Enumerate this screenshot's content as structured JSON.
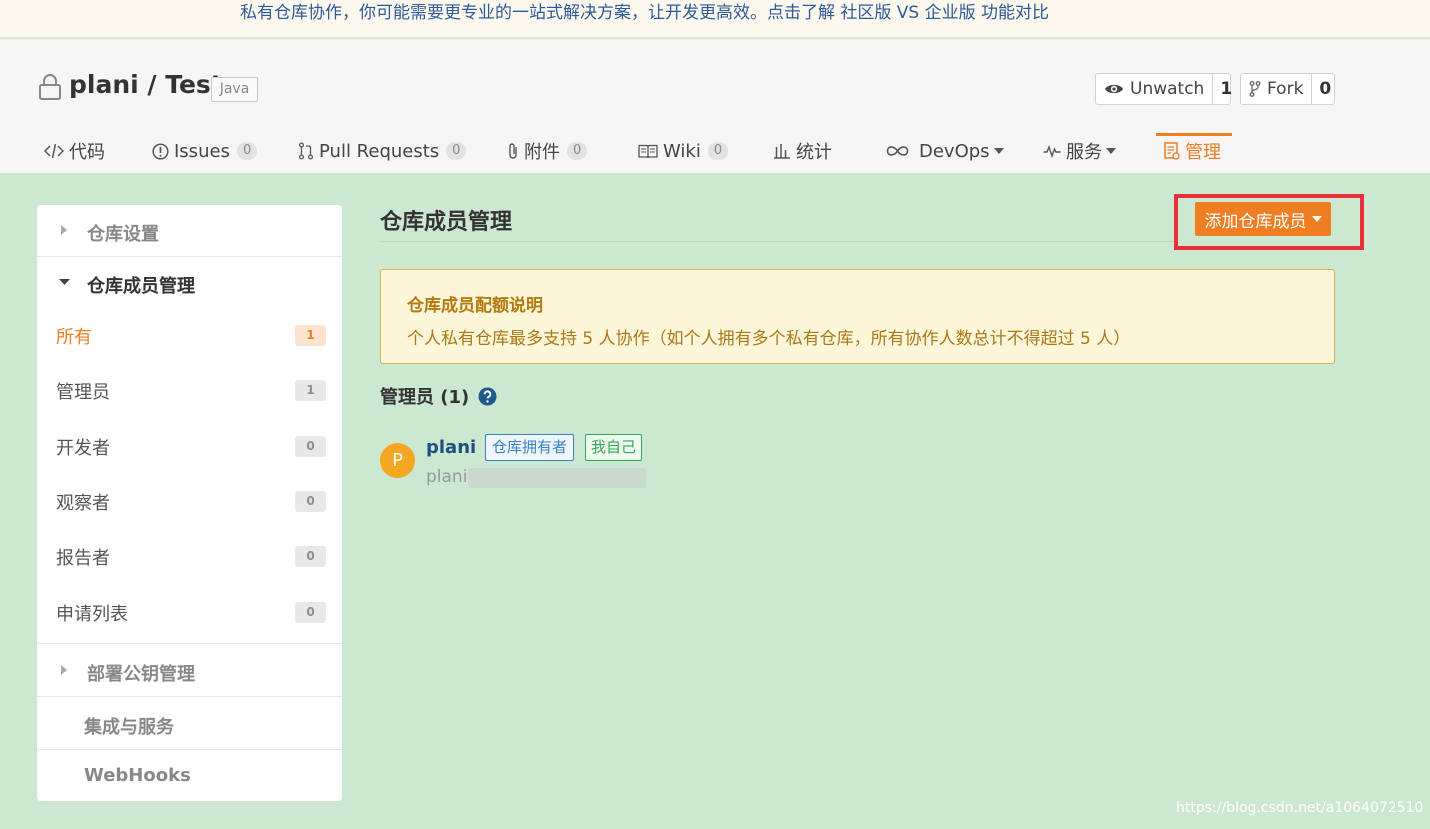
{
  "banner": {
    "text": "私有仓库协作，你可能需要更专业的一站式解决方案，让开发更高效。点击了解 社区版 VS 企业版 功能对比"
  },
  "repo": {
    "title": "plani / Test",
    "language": "Java"
  },
  "actions": {
    "watch": {
      "label": "Unwatch",
      "count": "1"
    },
    "fork": {
      "label": "Fork",
      "count": "0"
    }
  },
  "tabs": [
    {
      "label": "代码",
      "icon": "code-icon"
    },
    {
      "label": "Issues",
      "count": "0",
      "icon": "issue-icon"
    },
    {
      "label": "Pull Requests",
      "count": "0",
      "icon": "pull-request-icon"
    },
    {
      "label": "附件",
      "count": "0",
      "icon": "paperclip-icon"
    },
    {
      "label": "Wiki",
      "count": "0",
      "icon": "book-icon"
    },
    {
      "label": "统计",
      "icon": "bar-chart-icon"
    },
    {
      "label": "DevOps",
      "icon": "infinity-icon"
    },
    {
      "label": "服务",
      "icon": "pulse-icon"
    },
    {
      "label": "管理",
      "icon": "manage-icon",
      "active": true
    }
  ],
  "sidebar": {
    "sections": [
      {
        "label": "仓库设置"
      },
      {
        "label": "仓库成员管理"
      },
      {
        "label": "部署公钥管理"
      },
      {
        "label": "集成与服务"
      },
      {
        "label": "WebHooks"
      }
    ],
    "items": [
      {
        "label": "所有",
        "count": "1",
        "active": true
      },
      {
        "label": "管理员",
        "count": "1"
      },
      {
        "label": "开发者",
        "count": "0"
      },
      {
        "label": "观察者",
        "count": "0"
      },
      {
        "label": "报告者",
        "count": "0"
      },
      {
        "label": "申请列表",
        "count": "0"
      }
    ]
  },
  "main": {
    "title": "仓库成员管理",
    "add_button": "添加仓库成员",
    "notice": {
      "title": "仓库成员配额说明",
      "text": "个人私有仓库最多支持 5 人协作（如个人拥有多个私有仓库，所有协作人数总计不得超过 5 人）"
    },
    "group_title": "管理员 (1)",
    "member": {
      "avatar_letter": "P",
      "name": "plani",
      "tag_owner": "仓库拥有者",
      "tag_self": "我自己",
      "sub": "plani"
    }
  },
  "watermark": "https://blog.csdn.net/a1064072510",
  "colors": {
    "accent": "#ef7d22",
    "background": "#cce8d0",
    "highlight_outline": "#e8303a"
  }
}
